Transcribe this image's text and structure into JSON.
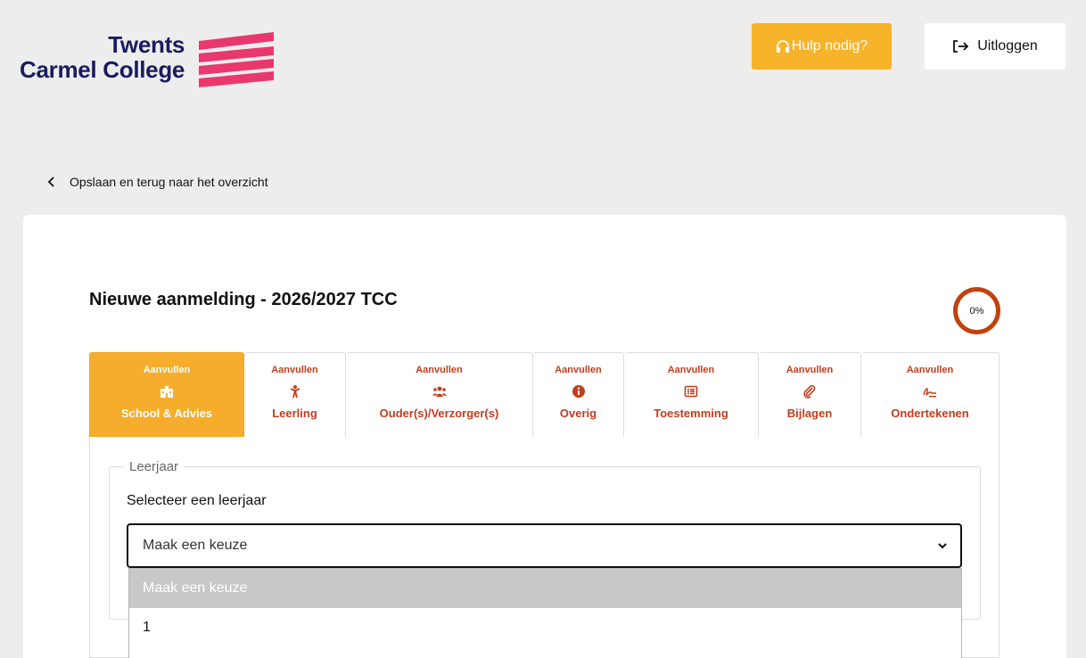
{
  "brand": {
    "name_line1": "Twents",
    "name_line2": "Carmel College",
    "text_color": "#1a1c5e",
    "mark_color": "#e8386d"
  },
  "header": {
    "help_label": "Hulp nodig?",
    "logout_label": "Uitloggen",
    "help_color": "#f7b329"
  },
  "back_link": {
    "label": "Opslaan en terug naar het overzicht"
  },
  "form": {
    "title": "Nieuwe aanmelding - 2026/2027 TCC",
    "progress": {
      "value": 0,
      "label": "0%",
      "color": "#c2410c"
    }
  },
  "tabs": [
    {
      "status": "Aanvullen",
      "label": "School & Advies",
      "icon": "school-icon",
      "active": true
    },
    {
      "status": "Aanvullen",
      "label": "Leerling",
      "icon": "child-icon",
      "active": false
    },
    {
      "status": "Aanvullen",
      "label": "Ouder(s)/Verzorger(s)",
      "icon": "users-icon",
      "active": false
    },
    {
      "status": "Aanvullen",
      "label": "Overig",
      "icon": "info-icon",
      "active": false
    },
    {
      "status": "Aanvullen",
      "label": "Toestemming",
      "icon": "list-icon",
      "active": false
    },
    {
      "status": "Aanvullen",
      "label": "Bijlagen",
      "icon": "paperclip-icon",
      "active": false
    },
    {
      "status": "Aanvullen",
      "label": "Ondertekenen",
      "icon": "signature-icon",
      "active": false
    }
  ],
  "leerjaar": {
    "legend": "Leerjaar",
    "label": "Selecteer een leerjaar",
    "selected": "Maak een keuze",
    "options": [
      "Maak een keuze",
      "1"
    ]
  }
}
